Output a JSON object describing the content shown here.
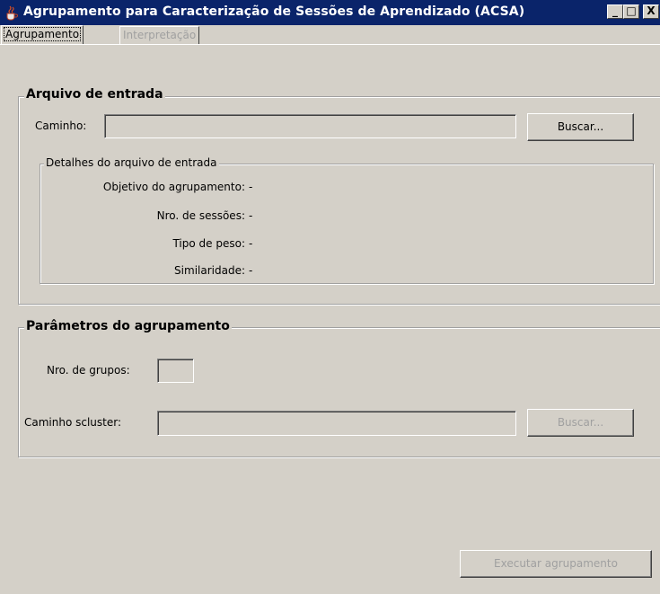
{
  "window": {
    "title": "Agrupamento para Caracterização de Sessões de Aprendizado (ACSA)",
    "controls": {
      "minimize": "_",
      "maximize": "□",
      "close": "X"
    }
  },
  "tabs": [
    {
      "label": "Agrupamento",
      "active": true,
      "enabled": true
    },
    {
      "label": "Interpretação",
      "active": false,
      "enabled": false
    }
  ],
  "input_file": {
    "legend": "Arquivo de entrada",
    "path_label": "Caminho:",
    "path_value": "",
    "browse_label": "Buscar...",
    "details": {
      "legend": "Detalhes do arquivo de entrada",
      "rows": [
        {
          "label": "Objetivo do agrupamento:",
          "value": "-"
        },
        {
          "label": "Nro. de sessões:",
          "value": "-"
        },
        {
          "label": "Tipo de peso:",
          "value": "-"
        },
        {
          "label": "Similaridade:",
          "value": "-"
        }
      ]
    }
  },
  "params": {
    "legend": "Parâmetros do agrupamento",
    "groups_label": "Nro. de grupos:",
    "groups_value": "",
    "scluster_label": "Caminho scluster:",
    "scluster_value": "",
    "browse_label": "Buscar..."
  },
  "run_button_label": "Executar agrupamento",
  "colors": {
    "titlebar": "#0a246a",
    "face": "#d4d0c8",
    "disabled_text": "#a0a0a0"
  },
  "icons": {
    "app": "java-cup-icon"
  }
}
